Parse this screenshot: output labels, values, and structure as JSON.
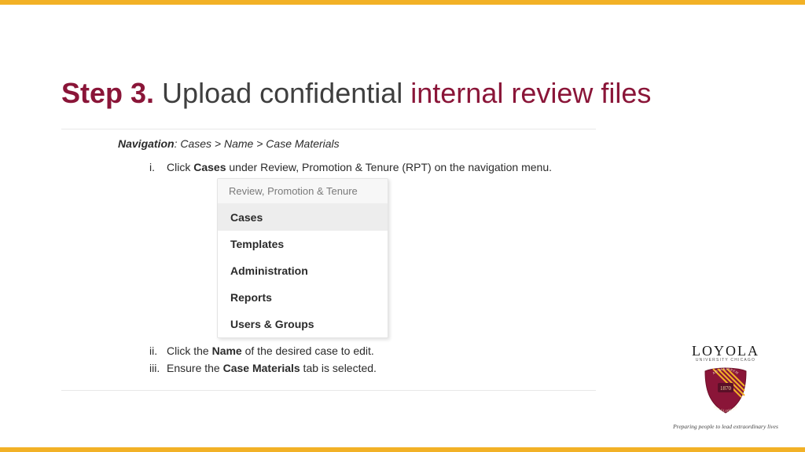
{
  "title": {
    "step": "Step 3.",
    "mid": " Upload confidential ",
    "suffix": "internal review files"
  },
  "navigation": {
    "label": "Navigation",
    "path": ": Cases > Name > Case Materials"
  },
  "instructions": {
    "i": {
      "idx": "i.",
      "pre": "Click ",
      "bold": "Cases",
      "post": " under Review, Promotion & Tenure (RPT) on the navigation menu."
    },
    "ii": {
      "idx": "ii.",
      "pre": "Click the ",
      "bold": "Name",
      "post": " of the desired case to edit."
    },
    "iii": {
      "idx": "iii.",
      "pre": "Ensure the ",
      "bold": "Case Materials",
      "post": " tab is selected."
    }
  },
  "menu": {
    "header": "Review, Promotion & Tenure",
    "items": [
      "Cases",
      "Templates",
      "Administration",
      "Reports",
      "Users & Groups"
    ]
  },
  "brand": {
    "name": "LOYOLA",
    "sub": "UNIVERSITY CHICAGO",
    "motto_top": "AD MAJOREM",
    "motto_bottom": "DEI GLORIAM",
    "year": "1870",
    "tagline": "Preparing people to lead extraordinary lives"
  },
  "colors": {
    "gold": "#f2b126",
    "maroon": "#8a1538"
  }
}
